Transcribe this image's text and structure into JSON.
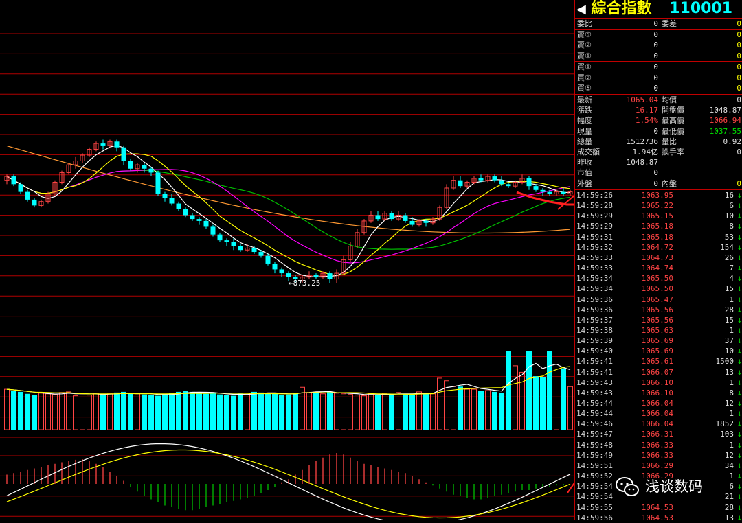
{
  "header": {
    "title": "綜合指數",
    "code": "110001",
    "arrow": "◀"
  },
  "order_book": {
    "ratio": {
      "label1": "委比",
      "value1": "0",
      "label2": "委差",
      "value2": "0"
    },
    "sell": [
      {
        "label": "賣⑤",
        "price": "0",
        "volume": "0"
      },
      {
        "label": "賣②",
        "price": "0",
        "volume": "0"
      },
      {
        "label": "賣①",
        "price": "0",
        "volume": "0"
      }
    ],
    "buy": [
      {
        "label": "買①",
        "price": "0",
        "volume": "0"
      },
      {
        "label": "買②",
        "price": "0",
        "volume": "0"
      },
      {
        "label": "買⑤",
        "price": "0",
        "volume": "0"
      }
    ]
  },
  "quote": [
    {
      "label1": "最新",
      "value1": "1065.04",
      "label2": "均價",
      "value2": "0"
    },
    {
      "label1": "漲跌",
      "value1": "16.17",
      "label2": "開盤價",
      "value2": "1048.87"
    },
    {
      "label1": "幅度",
      "value1": "1.54%",
      "label2": "最高價",
      "value2": "1066.94"
    },
    {
      "label1": "現量",
      "value1": "0",
      "label2": "最低價",
      "value2": "1037.55"
    },
    {
      "label1": "總量",
      "value1": "1512736",
      "label2": "量比",
      "value2": "0.92"
    },
    {
      "label1": "成交額",
      "value1": "1.94亿",
      "label2": "換手率",
      "value2": "0"
    },
    {
      "label1": "昨收",
      "value1": "1048.87",
      "label2": "",
      "value2": ""
    },
    {
      "label1": "市值",
      "value1": "0",
      "label2": "",
      "value2": ""
    },
    {
      "label1": "外盤",
      "value1": "0",
      "label2": "內盤",
      "value2": "0"
    }
  ],
  "ticks": [
    {
      "time": "14:59:26",
      "price": "1063.95",
      "volume": "16",
      "dir": "↓"
    },
    {
      "time": "14:59:28",
      "price": "1065.22",
      "volume": "6",
      "dir": "↓"
    },
    {
      "time": "14:59:29",
      "price": "1065.15",
      "volume": "10",
      "dir": "↓"
    },
    {
      "time": "14:59:29",
      "price": "1065.18",
      "volume": "8",
      "dir": "↓"
    },
    {
      "time": "14:59:31",
      "price": "1065.18",
      "volume": "53",
      "dir": "↓"
    },
    {
      "time": "14:59:32",
      "price": "1064.72",
      "volume": "154",
      "dir": "↓"
    },
    {
      "time": "14:59:33",
      "price": "1064.73",
      "volume": "26",
      "dir": "↓"
    },
    {
      "time": "14:59:33",
      "price": "1064.74",
      "volume": "7",
      "dir": "↓"
    },
    {
      "time": "14:59:34",
      "price": "1065.50",
      "volume": "4",
      "dir": "↓"
    },
    {
      "time": "14:59:34",
      "price": "1065.50",
      "volume": "15",
      "dir": "↓"
    },
    {
      "time": "14:59:36",
      "price": "1065.47",
      "volume": "1",
      "dir": "↓"
    },
    {
      "time": "14:59:36",
      "price": "1065.56",
      "volume": "28",
      "dir": "↓"
    },
    {
      "time": "14:59:37",
      "price": "1065.56",
      "volume": "15",
      "dir": "↓"
    },
    {
      "time": "14:59:38",
      "price": "1065.63",
      "volume": "1",
      "dir": "↓"
    },
    {
      "time": "14:59:39",
      "price": "1065.69",
      "volume": "37",
      "dir": "↓"
    },
    {
      "time": "14:59:40",
      "price": "1065.69",
      "volume": "10",
      "dir": "↓"
    },
    {
      "time": "14:59:41",
      "price": "1065.61",
      "volume": "1500",
      "dir": "↓"
    },
    {
      "time": "14:59:41",
      "price": "1066.07",
      "volume": "13",
      "dir": "↓"
    },
    {
      "time": "14:59:43",
      "price": "1066.10",
      "volume": "1",
      "dir": "↓"
    },
    {
      "time": "14:59:43",
      "price": "1066.10",
      "volume": "8",
      "dir": "↓"
    },
    {
      "time": "14:59:44",
      "price": "1066.04",
      "volume": "12",
      "dir": "↓"
    },
    {
      "time": "14:59:44",
      "price": "1066.04",
      "volume": "1",
      "dir": "↓"
    },
    {
      "time": "14:59:46",
      "price": "1066.04",
      "volume": "1852",
      "dir": "↓"
    },
    {
      "time": "14:59:47",
      "price": "1066.31",
      "volume": "103",
      "dir": "↓"
    },
    {
      "time": "14:59:48",
      "price": "1066.33",
      "volume": "1",
      "dir": "↓"
    },
    {
      "time": "14:59:49",
      "price": "1066.33",
      "volume": "12",
      "dir": "↓"
    },
    {
      "time": "14:59:51",
      "price": "1066.29",
      "volume": "34",
      "dir": "↓"
    },
    {
      "time": "14:59:52",
      "price": "1066.29",
      "volume": "1",
      "dir": "↓"
    },
    {
      "time": "14:59:54",
      "price": "",
      "volume": "6",
      "dir": "↓"
    },
    {
      "time": "14:59:54",
      "price": "",
      "volume": "21",
      "dir": "↓"
    },
    {
      "time": "14:59:55",
      "price": "1064.53",
      "volume": "28",
      "dir": "↓"
    },
    {
      "time": "14:59:56",
      "price": "1064.53",
      "volume": "13",
      "dir": "↓"
    }
  ],
  "watermark": {
    "text": "浅谈数码",
    "icon": "wechat-icon"
  },
  "colors": {
    "up": "#ff4444",
    "down": "#00ffff",
    "grid": "#b00000",
    "ma5": "#ffffff",
    "ma10": "#ffff00",
    "ma20": "#ff00ff",
    "ma30": "#00c000",
    "ma60": "#ff9933"
  },
  "chart_data": {
    "type": "candlestick",
    "low_label": "873.25",
    "candles": [
      [
        0.54,
        0.56,
        0.52,
        0.57
      ],
      [
        0.56,
        0.52,
        0.51,
        0.57
      ],
      [
        0.52,
        0.48,
        0.47,
        0.53
      ],
      [
        0.48,
        0.44,
        0.43,
        0.49
      ],
      [
        0.44,
        0.41,
        0.4,
        0.45
      ],
      [
        0.41,
        0.43,
        0.4,
        0.44
      ],
      [
        0.43,
        0.47,
        0.42,
        0.48
      ],
      [
        0.47,
        0.53,
        0.46,
        0.54
      ],
      [
        0.53,
        0.58,
        0.52,
        0.59
      ],
      [
        0.58,
        0.62,
        0.57,
        0.63
      ],
      [
        0.62,
        0.64,
        0.6,
        0.66
      ],
      [
        0.64,
        0.67,
        0.63,
        0.68
      ],
      [
        0.67,
        0.7,
        0.66,
        0.71
      ],
      [
        0.7,
        0.73,
        0.69,
        0.74
      ],
      [
        0.73,
        0.72,
        0.7,
        0.75
      ],
      [
        0.72,
        0.74,
        0.71,
        0.75
      ],
      [
        0.74,
        0.71,
        0.69,
        0.75
      ],
      [
        0.71,
        0.64,
        0.62,
        0.72
      ],
      [
        0.64,
        0.6,
        0.59,
        0.65
      ],
      [
        0.6,
        0.62,
        0.58,
        0.63
      ],
      [
        0.62,
        0.6,
        0.58,
        0.63
      ],
      [
        0.6,
        0.58,
        0.56,
        0.61
      ],
      [
        0.58,
        0.47,
        0.46,
        0.59
      ],
      [
        0.47,
        0.45,
        0.43,
        0.48
      ],
      [
        0.45,
        0.42,
        0.41,
        0.47
      ],
      [
        0.42,
        0.39,
        0.38,
        0.43
      ],
      [
        0.39,
        0.36,
        0.35,
        0.4
      ],
      [
        0.36,
        0.34,
        0.33,
        0.37
      ],
      [
        0.34,
        0.33,
        0.31,
        0.35
      ],
      [
        0.33,
        0.3,
        0.29,
        0.34
      ],
      [
        0.3,
        0.26,
        0.25,
        0.31
      ],
      [
        0.26,
        0.23,
        0.22,
        0.27
      ],
      [
        0.23,
        0.22,
        0.2,
        0.24
      ],
      [
        0.22,
        0.2,
        0.18,
        0.24
      ],
      [
        0.2,
        0.18,
        0.17,
        0.21
      ],
      [
        0.18,
        0.19,
        0.17,
        0.21
      ],
      [
        0.19,
        0.17,
        0.16,
        0.2
      ],
      [
        0.17,
        0.15,
        0.14,
        0.18
      ],
      [
        0.15,
        0.11,
        0.1,
        0.16
      ],
      [
        0.11,
        0.08,
        0.06,
        0.12
      ],
      [
        0.08,
        0.06,
        0.04,
        0.09
      ],
      [
        0.06,
        0.04,
        0.02,
        0.07
      ],
      [
        0.04,
        0.03,
        0.01,
        0.05
      ],
      [
        0.03,
        0.04,
        0.01,
        0.05
      ],
      [
        0.04,
        0.05,
        0.03,
        0.07
      ],
      [
        0.05,
        0.04,
        0.03,
        0.06
      ],
      [
        0.04,
        0.06,
        0.03,
        0.07
      ],
      [
        0.06,
        0.03,
        0.01,
        0.07
      ],
      [
        0.03,
        0.06,
        0.01,
        0.08
      ],
      [
        0.06,
        0.13,
        0.05,
        0.15
      ],
      [
        0.13,
        0.2,
        0.12,
        0.22
      ],
      [
        0.2,
        0.27,
        0.19,
        0.29
      ],
      [
        0.27,
        0.33,
        0.26,
        0.34
      ],
      [
        0.33,
        0.36,
        0.32,
        0.38
      ],
      [
        0.36,
        0.34,
        0.33,
        0.38
      ],
      [
        0.34,
        0.37,
        0.33,
        0.38
      ],
      [
        0.37,
        0.34,
        0.33,
        0.38
      ],
      [
        0.34,
        0.36,
        0.33,
        0.38
      ],
      [
        0.36,
        0.33,
        0.32,
        0.37
      ],
      [
        0.33,
        0.31,
        0.3,
        0.35
      ],
      [
        0.31,
        0.33,
        0.3,
        0.34
      ],
      [
        0.33,
        0.32,
        0.3,
        0.34
      ],
      [
        0.32,
        0.34,
        0.31,
        0.35
      ],
      [
        0.34,
        0.4,
        0.33,
        0.41
      ],
      [
        0.4,
        0.5,
        0.39,
        0.52
      ],
      [
        0.5,
        0.54,
        0.49,
        0.56
      ],
      [
        0.54,
        0.51,
        0.5,
        0.56
      ],
      [
        0.51,
        0.53,
        0.5,
        0.54
      ],
      [
        0.53,
        0.55,
        0.52,
        0.56
      ],
      [
        0.55,
        0.54,
        0.53,
        0.57
      ],
      [
        0.54,
        0.56,
        0.53,
        0.57
      ],
      [
        0.56,
        0.54,
        0.53,
        0.57
      ],
      [
        0.54,
        0.52,
        0.51,
        0.56
      ],
      [
        0.52,
        0.51,
        0.5,
        0.53
      ],
      [
        0.51,
        0.53,
        0.5,
        0.54
      ],
      [
        0.53,
        0.55,
        0.52,
        0.57
      ],
      [
        0.55,
        0.51,
        0.49,
        0.56
      ],
      [
        0.51,
        0.49,
        0.48,
        0.52
      ],
      [
        0.49,
        0.48,
        0.46,
        0.5
      ],
      [
        0.48,
        0.47,
        0.46,
        0.49
      ],
      [
        0.47,
        0.48,
        0.46,
        0.49
      ],
      [
        0.48,
        0.47,
        0.46,
        0.5
      ],
      [
        0.47,
        0.48,
        0.46,
        0.49
      ]
    ],
    "volume": [
      0.62,
      0.6,
      0.58,
      0.55,
      0.53,
      0.56,
      0.55,
      0.54,
      0.57,
      0.58,
      0.52,
      0.55,
      0.53,
      0.56,
      0.54,
      0.55,
      0.57,
      0.58,
      0.56,
      0.55,
      0.54,
      0.53,
      0.52,
      0.55,
      0.56,
      0.58,
      0.6,
      0.58,
      0.56,
      0.55,
      0.57,
      0.54,
      0.53,
      0.52,
      0.55,
      0.56,
      0.58,
      0.57,
      0.56,
      0.55,
      0.53,
      0.54,
      0.56,
      0.65,
      0.57,
      0.58,
      0.55,
      0.58,
      0.56,
      0.55,
      0.54,
      0.53,
      0.52,
      0.55,
      0.54,
      0.56,
      0.53,
      0.57,
      0.55,
      0.54,
      0.58,
      0.56,
      0.55,
      0.79,
      0.75,
      0.66,
      0.66,
      0.62,
      0.62,
      0.6,
      0.6,
      0.58,
      0.56,
      1.2,
      0.98,
      0.88,
      1.2,
      0.82,
      0.8,
      1.2,
      1.0,
      0.94,
      0.66
    ],
    "macd": [
      0.3,
      0.35,
      0.4,
      0.45,
      0.5,
      0.55,
      0.6,
      0.65,
      0.7,
      0.75,
      0.78,
      0.8,
      0.75,
      0.65,
      0.55,
      0.4,
      0.25,
      0.1,
      -0.1,
      -0.25,
      -0.4,
      -0.5,
      -0.6,
      -0.7,
      -0.75,
      -0.8,
      -0.85,
      -0.85,
      -0.8,
      -0.75,
      -0.7,
      -0.65,
      -0.6,
      -0.55,
      -0.5,
      -0.45,
      -0.4,
      -0.3,
      -0.2,
      -0.1,
      0.05,
      0.15,
      0.3,
      0.45,
      0.6,
      0.75,
      0.85,
      0.95,
      1.0,
      0.95,
      0.85,
      0.75,
      0.65,
      0.6,
      0.55,
      0.5,
      0.45,
      0.4,
      0.35,
      0.25,
      0.15,
      0.05,
      -0.05,
      -0.15,
      -0.25,
      -0.35,
      -0.4,
      -0.45,
      -0.5,
      -0.5,
      -0.45,
      -0.4,
      -0.35,
      -0.3,
      -0.25,
      -0.2,
      -0.2,
      -0.15,
      -0.1,
      -0.1,
      -0.05,
      -0.05,
      0
    ]
  }
}
